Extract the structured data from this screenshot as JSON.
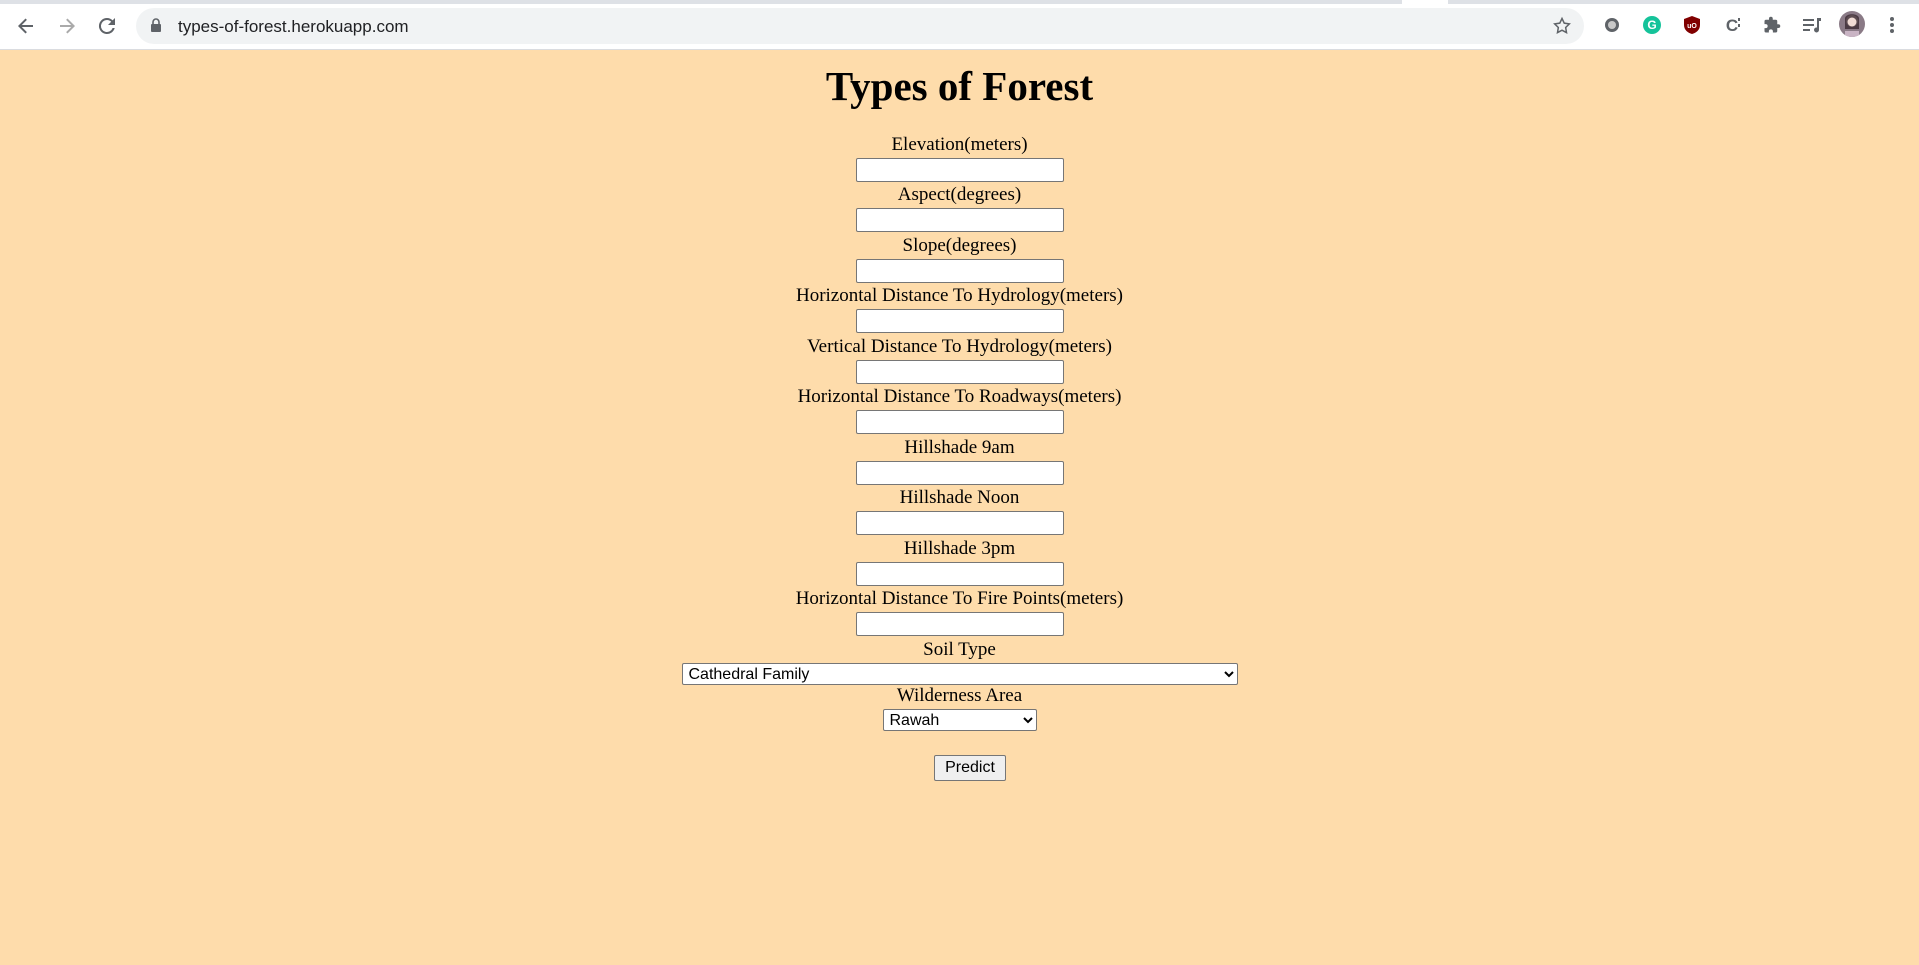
{
  "browser": {
    "url": "types-of-forest.herokuapp.com",
    "icons": [
      "back-icon",
      "forward-icon",
      "reload-icon",
      "lock-icon",
      "star-icon",
      "extension-circle-icon",
      "grammarly-icon",
      "ublock-icon",
      "extension-c-icon",
      "puzzle-icon",
      "media-icon",
      "profile-avatar",
      "menu-icon"
    ]
  },
  "page": {
    "title": "Types of Forest",
    "fields": [
      {
        "label": "Elevation(meters)",
        "value": ""
      },
      {
        "label": "Aspect(degrees)",
        "value": ""
      },
      {
        "label": "Slope(degrees)",
        "value": ""
      },
      {
        "label": "Horizontal Distance To Hydrology(meters)",
        "value": ""
      },
      {
        "label": "Vertical Distance To Hydrology(meters)",
        "value": ""
      },
      {
        "label": "Horizontal Distance To Roadways(meters)",
        "value": ""
      },
      {
        "label": "Hillshade 9am",
        "value": ""
      },
      {
        "label": "Hillshade Noon",
        "value": ""
      },
      {
        "label": "Hillshade 3pm",
        "value": ""
      },
      {
        "label": "Horizontal Distance To Fire Points(meters)",
        "value": ""
      }
    ],
    "soil_type": {
      "label": "Soil Type",
      "selected": "Cathedral Family"
    },
    "wilderness_area": {
      "label": "Wilderness Area",
      "selected": "Rawah"
    },
    "predict_label": "Predict"
  },
  "colors": {
    "background": "#fedcab"
  }
}
